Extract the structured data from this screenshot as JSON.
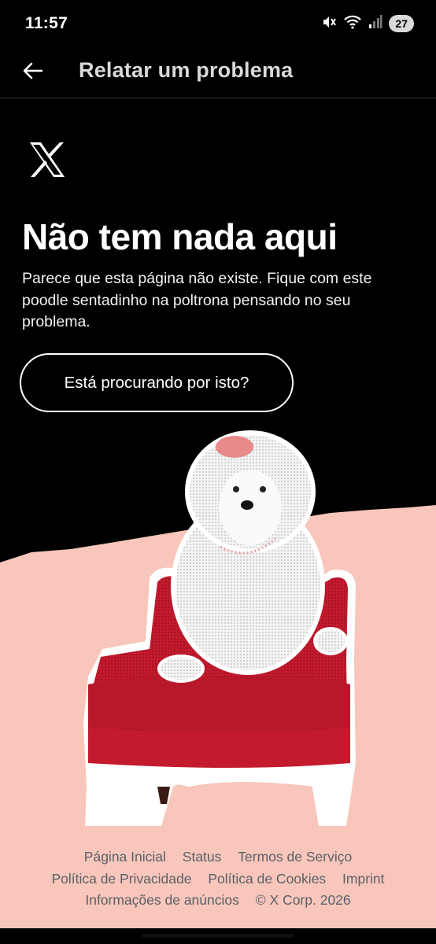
{
  "status_bar": {
    "time": "11:57",
    "battery": "27"
  },
  "app_bar": {
    "title": "Relatar um problema"
  },
  "content": {
    "headline": "Não tem nada aqui",
    "description": "Parece que esta página não existe. Fique com este poodle sentadinho na poltrona pensando no seu problema.",
    "cta_label": "Está procurando por isto?"
  },
  "footer": {
    "row1": [
      "Página Inicial",
      "Status",
      "Termos de Serviço"
    ],
    "row2": [
      "Política de Privacidade",
      "Política de Cookies",
      "Imprint"
    ],
    "row3": [
      "Informações de anúncios",
      "© X Corp. 2026"
    ]
  },
  "colors": {
    "background": "#000000",
    "pink_backdrop": "#f8c6bb",
    "chair_red": "#c41a2d",
    "footer_text": "#5a6169"
  },
  "icons": [
    "mute-icon",
    "wifi-icon",
    "signal-icon",
    "back-arrow-icon",
    "x-logo-icon"
  ]
}
